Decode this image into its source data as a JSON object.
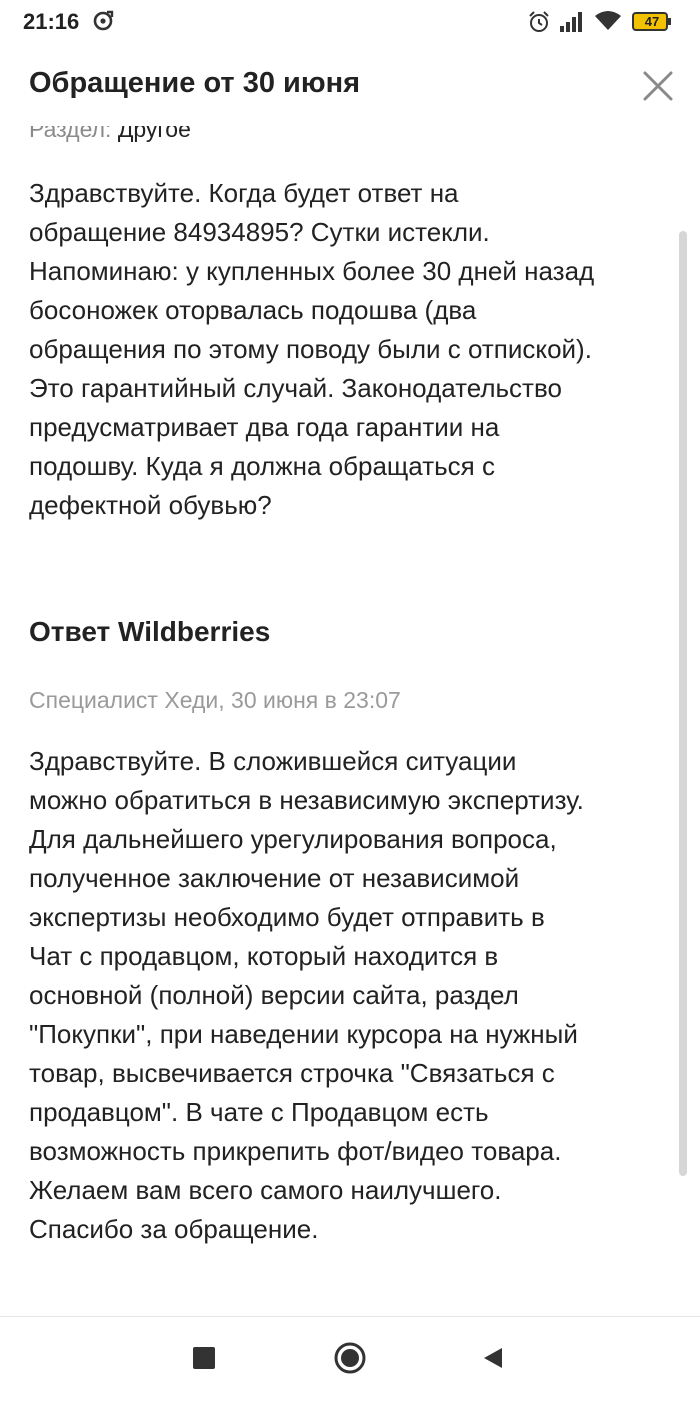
{
  "status_bar": {
    "time": "21:16",
    "battery_level": "47",
    "icons": [
      "sync-icon",
      "alarm-icon",
      "signal-icon",
      "wifi-icon",
      "battery-icon"
    ]
  },
  "header": {
    "title": "Обращение от 30 июня",
    "close_icon": "close-icon"
  },
  "request": {
    "section_label": "Раздел:",
    "section_value": "Другое",
    "text": "Здравствуйте. Когда будет ответ на\nобращение 84934895? Сутки истекли.\nНапоминаю: у купленных более 30 дней назад\nбосоножек оторвалась подошва (два\nобращения по этому поводу были с отпиской).\nЭто гарантийный случай. Законодательство\nпредусматривает два года гарантии на\nподошву. Куда я должна обращаться с\nдефектной обувью?"
  },
  "answer": {
    "title": "Ответ Wildberries",
    "meta": "Специалист Хеди, 30 июня в 23:07",
    "text": "Здравствуйте. В сложившейся ситуации\nможно обратиться в независимую экспертизу.\nДля дальнейшего урегулирования вопроса,\nполученное заключение от независимой\nэкспертизы необходимо будет отправить в\nЧат с продавцом, который находится в\nосновной (полной) версии сайта, раздел\n\"Покупки\", при наведении курсора на нужный\nтовар, высвечивается строчка \"Связаться с\nпродавцом\". В чате с Продавцом есть\nвозможность прикрепить фот/видео товара.\nЖелаем вам всего самого наилучшего.\nСпасибо за обращение."
  },
  "nav_bar": {
    "icons": [
      "recent-apps-icon",
      "home-icon",
      "back-icon"
    ]
  },
  "colors": {
    "text": "#222222",
    "muted": "#9a9a9a",
    "background": "#ffffff"
  }
}
